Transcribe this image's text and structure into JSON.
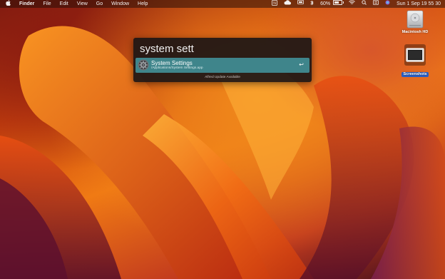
{
  "menubar": {
    "apple_icon": "apple-logo-icon",
    "app_name": "Finder",
    "menus": [
      "File",
      "Edit",
      "View",
      "Go",
      "Window",
      "Help"
    ],
    "battery_percent": "60%",
    "datetime": "Sun 1 Sep  19 55 30"
  },
  "alfred": {
    "query": "system sett",
    "results": [
      {
        "title": "System Settings",
        "path": "/Applications/System Settings.app",
        "icon": "gear-icon",
        "action_icon": "return-key-icon"
      }
    ],
    "return_glyph": "↩",
    "footer": "Alfred Update Available",
    "accent_color": "#3f858b"
  },
  "desktop": {
    "items": [
      {
        "label": "Macintosh HD",
        "icon": "hard-drive-icon",
        "selected": false
      },
      {
        "label": "Screenshots",
        "icon": "folder-icon",
        "selected": true
      }
    ]
  }
}
